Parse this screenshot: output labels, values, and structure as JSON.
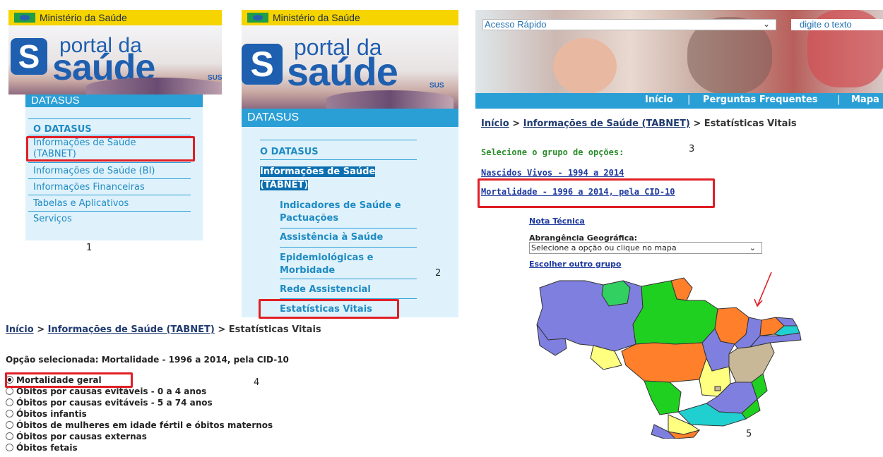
{
  "panel1": {
    "gov_text": "Ministério da Saúde",
    "logo_portal": "portal da",
    "logo_saude": "saúde",
    "logo_sus": "SUS",
    "datasus": "DATASUS",
    "menu": [
      "O DATASUS",
      "Informações de Saúde",
      "(TABNET)",
      "Informações de Saúde (BI)",
      "Informações Financeiras",
      "Tabelas e Aplicativos",
      "Serviços"
    ],
    "step": "1"
  },
  "panel2": {
    "gov_text": "Ministério da Saúde",
    "logo_portal": "portal da",
    "logo_saude": "saúde",
    "logo_sus": "SUS",
    "datasus": "DATASUS",
    "menu_top": "O DATASUS",
    "menu_selected_1": "Informações de Saúde",
    "menu_selected_2": "(TABNET)",
    "submenu": [
      "Indicadores de Saúde e",
      "Pactuações",
      "Assistência à Saúde",
      "Epidemiológicas e",
      "Morbidade",
      "Rede Assistencial",
      "Estatísticas Vitais"
    ],
    "step": "2"
  },
  "panel3": {
    "acesso": "Acesso Rápido",
    "digite": "digite o texto",
    "nav": [
      "Início",
      "|",
      "Perguntas Frequentes",
      "|",
      "Mapa"
    ],
    "crumb_home": "Início",
    "crumb_sep": ">",
    "crumb_mid": "Informações de Saúde (TABNET)",
    "crumb_last": "Estatísticas Vitais",
    "select_group": "Selecione o grupo de opções:",
    "link_nascidos": "Nascidos Vivos - 1994 a 2014",
    "link_mortalidade": "Mortalidade - 1996 a 2014, pela CID-10",
    "step": "3"
  },
  "panel4": {
    "crumb_home": "Início",
    "crumb_sep": ">",
    "crumb_mid": "Informações de Saúde (TABNET)",
    "crumb_last": "Estatísticas Vitais",
    "selected": "Opção selecionada: Mortalidade - 1996 a 2014, pela CID-10",
    "options": [
      "Mortalidade geral",
      "Óbitos por causas evitáveis - 0 a 4 anos",
      "Óbitos por causas evitáveis - 5 a 74 anos",
      "Óbitos infantis",
      "Óbitos de mulheres em idade fértil e óbitos maternos",
      "Óbitos por causas externas",
      "Óbitos fetais"
    ],
    "step": "4"
  },
  "panel5": {
    "nota": "Nota Técnica",
    "abrangencia": "Abrangência Geográfica:",
    "select_value": "Selecione a opção ou clique no mapa",
    "escolher": "Escolher outro grupo",
    "step": "5"
  },
  "colors": {
    "accent_blue": "#2a9fd6",
    "highlight_red": "#e11f26",
    "link_blue": "#1f8bc4",
    "green_text": "#2a8c2a",
    "gov_yellow": "#f5d400"
  },
  "icons": [
    "brazil-flag-icon",
    "chevron-down-icon",
    "radio-icon",
    "red-arrow-icon",
    "brazil-map"
  ]
}
